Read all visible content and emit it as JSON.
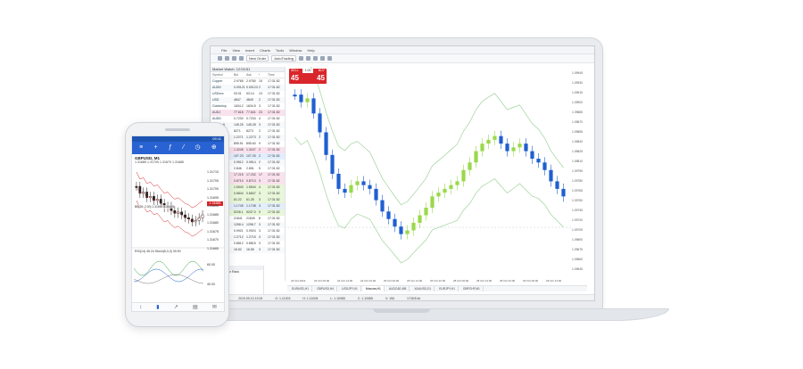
{
  "desktop": {
    "menu": [
      "File",
      "View",
      "Insert",
      "Charts",
      "Tools",
      "Window",
      "Help"
    ],
    "toolbar": {
      "new_order": "New Order",
      "algo_trading": "AutoTrading"
    },
    "market_watch": {
      "title": "Market Watch: 12:03:51",
      "columns": [
        "Symbol",
        "Bid",
        "Ask",
        "!",
        "Time"
      ],
      "rows": [
        {
          "symbol": "Copper",
          "bid": "2.9765",
          "ask": "2.9780",
          "spread": "15",
          "time": "17:31:52"
        },
        {
          "symbol": "AUDD",
          "bid": "0.00121",
          "ask": "0.00123",
          "spread": "2",
          "time": "17:31:52"
        },
        {
          "symbol": "USDxxx",
          "bid": "93.01",
          "ask": "93.14",
          "spread": "13",
          "time": "17:31:52"
        },
        {
          "symbol": "USD",
          "bid": "4847",
          "ask": "4849",
          "spread": "2",
          "time": "17:31:52"
        },
        {
          "symbol": "Goldvelop",
          "bid": "1634.2",
          "ask": "1634.5",
          "spread": "3",
          "time": "17:31:52"
        },
        {
          "symbol": "AUDJ",
          "bid": "77.618",
          "ask": "77.641",
          "spread": "23",
          "time": "17:31:52"
        },
        {
          "symbol": "AUDD",
          "bid": "0.7230",
          "ask": "0.7234",
          "spread": "4",
          "time": "17:31:52"
        },
        {
          "symbol": "Pinecraft",
          "bid": "145.25",
          "ask": "145.28",
          "spread": "3",
          "time": "17:31:52"
        },
        {
          "symbol": "Monotch",
          "bid": "8271",
          "ask": "8273",
          "spread": "2",
          "time": "17:31:52"
        },
        {
          "symbol": "EURUSD",
          "bid": "1.2271",
          "ask": "1.2273",
          "spread": "2",
          "time": "17:31:52"
        },
        {
          "symbol": "Eur",
          "bid": "895.51",
          "ask": "895.60",
          "spread": "9",
          "time": "17:31:52"
        },
        {
          "symbol": "GBPUSD",
          "bid": "1.3245",
          "ask": "1.3247",
          "spread": "2",
          "time": "17:31:52"
        },
        {
          "symbol": "Euro",
          "bid": "107.23",
          "ask": "107.25",
          "spread": "2",
          "time": "17:31:52"
        },
        {
          "symbol": "Aus",
          "bid": "0.9512",
          "ask": "0.9514",
          "spread": "2",
          "time": "17:31:52"
        },
        {
          "symbol": "Gas",
          "bid": "2.846",
          "ask": "2.851",
          "spread": "5",
          "time": "17:31:52"
        },
        {
          "symbol": "Silver",
          "bid": "17.215",
          "ask": "17.232",
          "spread": "17",
          "time": "17:31:52"
        },
        {
          "symbol": "AUDx",
          "bid": "0.8710",
          "ask": "0.8713",
          "spread": "3",
          "time": "17:31:52"
        },
        {
          "symbol": "GBPx",
          "bid": "1.5540",
          "ask": "1.5544",
          "spread": "4",
          "time": "17:31:52"
        },
        {
          "symbol": "NZD",
          "bid": "0.6844",
          "ask": "0.6847",
          "spread": "3",
          "time": "17:31:52"
        },
        {
          "symbol": "Oil",
          "bid": "61.22",
          "ask": "61.25",
          "spread": "3",
          "time": "17:31:52"
        },
        {
          "symbol": "USDx",
          "bid": "1.1745",
          "ask": "1.1748",
          "spread": "3",
          "time": "17:31:52"
        },
        {
          "symbol": "Fra",
          "bid": "5236.1",
          "ask": "5237.0",
          "spread": "9",
          "time": "17:31:52"
        },
        {
          "symbol": "Jpn",
          "bid": "21841",
          "ask": "21849",
          "spread": "8",
          "time": "17:31:52"
        },
        {
          "symbol": "Gold",
          "bid": "1298.4",
          "ask": "1298.7",
          "spread": "3",
          "time": "17:31:52"
        },
        {
          "symbol": "CHF",
          "bid": "0.9921",
          "ask": "0.9924",
          "spread": "3",
          "time": "17:31:52"
        },
        {
          "symbol": "CAD",
          "bid": "1.2712",
          "ask": "1.2715",
          "spread": "3",
          "time": "17:31:52"
        },
        {
          "symbol": "Eu",
          "bid": "0.8812",
          "ask": "0.8815",
          "spread": "3",
          "time": "17:31:52"
        },
        {
          "symbol": "Ag",
          "bid": "16.52",
          "ask": "16.55",
          "spread": "3",
          "time": "17:31:52"
        }
      ]
    },
    "navigator": {
      "title": "Navigator",
      "items": [
        "Navigator Rank",
        "Accounts",
        "MetaQuotes-Demo",
        "1000999: demo-mt5",
        "435335: 'Prestige-Demo1'",
        "Indicators",
        "Expert Advisors",
        "1908 Scripts",
        "Jason Huxton Scripts",
        "4379514: Jones@Email.com",
        "7662781: news@example.io",
        "100799: Promo Indicators"
      ]
    },
    "one_click": {
      "sell_label": "SELL",
      "buy_label": "BUY",
      "lot": "1.00",
      "sell_price": "45",
      "buy_price": "45"
    },
    "chart_tabs": [
      "EURUSD,H1",
      "GBPUSD,H4",
      "USDJPY,H1",
      "Moscow,H1",
      "AUDCAD,M5",
      "XAUUSD,D1",
      "EURJPY,H1",
      "GBPCHF,M1"
    ],
    "statusbar": [
      "Default",
      "2019.09.13 13:00",
      "O: 1.11003",
      "H: 1.11008",
      "L: 1.10985",
      "C: 1.10985",
      "V: 156",
      "1726/5 kb"
    ],
    "chart_price_axis": [
      "1.09945",
      "1.09930",
      "1.09915",
      "1.09900",
      "1.09885",
      "1.09870",
      "1.09855",
      "1.09840",
      "1.09825",
      "1.09810",
      "1.09795",
      "1.09780",
      "1.09765",
      "1.09750",
      "1.09735",
      "1.09720",
      "1.09705",
      "1.09690",
      "1.09675",
      "1.09660",
      "1.09645"
    ],
    "chart_time_axis": [
      "23 Oct 2019",
      "24 Oct 06:00",
      "24 Oct 14:00",
      "24 Oct 22:00",
      "25 Oct 06:00",
      "25 Oct 14:00",
      "25 Oct 22:00",
      "28 Oct 06:00",
      "28 Oct 14:00",
      "28 Oct 22:00",
      "29 Oct 06:00",
      "29 Oct 14:00"
    ]
  },
  "phone": {
    "status_time": "09:11",
    "symbol": "GBPUSD, M1",
    "ohlc": "1.31685 1.31705 1.31670 1.31685",
    "bands_label": "BB(20, 2.00) 1.31690 1.31675",
    "price_tag": "1.31685",
    "axis": [
      "1.31710",
      "1.31705",
      "1.31700",
      "1.31695",
      "1.31690",
      "1.31685",
      "1.31680",
      "1.31675",
      "1.31670",
      "1.31665"
    ],
    "indicator_label": "RSI(14) 45.24 Stoch(5,3,3) 39.90",
    "ind_axis": [
      "60.00",
      "40.00"
    ],
    "dates": [
      "17 Oct 09:06",
      "17 Oct 09:08",
      "17 Oct 09:10"
    ],
    "tabs": [
      "Quotes",
      "Chart",
      "Trade",
      "History",
      "Messages"
    ]
  },
  "colors": {
    "bull": "#9ad84a",
    "bear": "#1f5fd0",
    "band": "#9fd39a",
    "accent": "#d9262b",
    "phone_bar": "#2962d2"
  }
}
